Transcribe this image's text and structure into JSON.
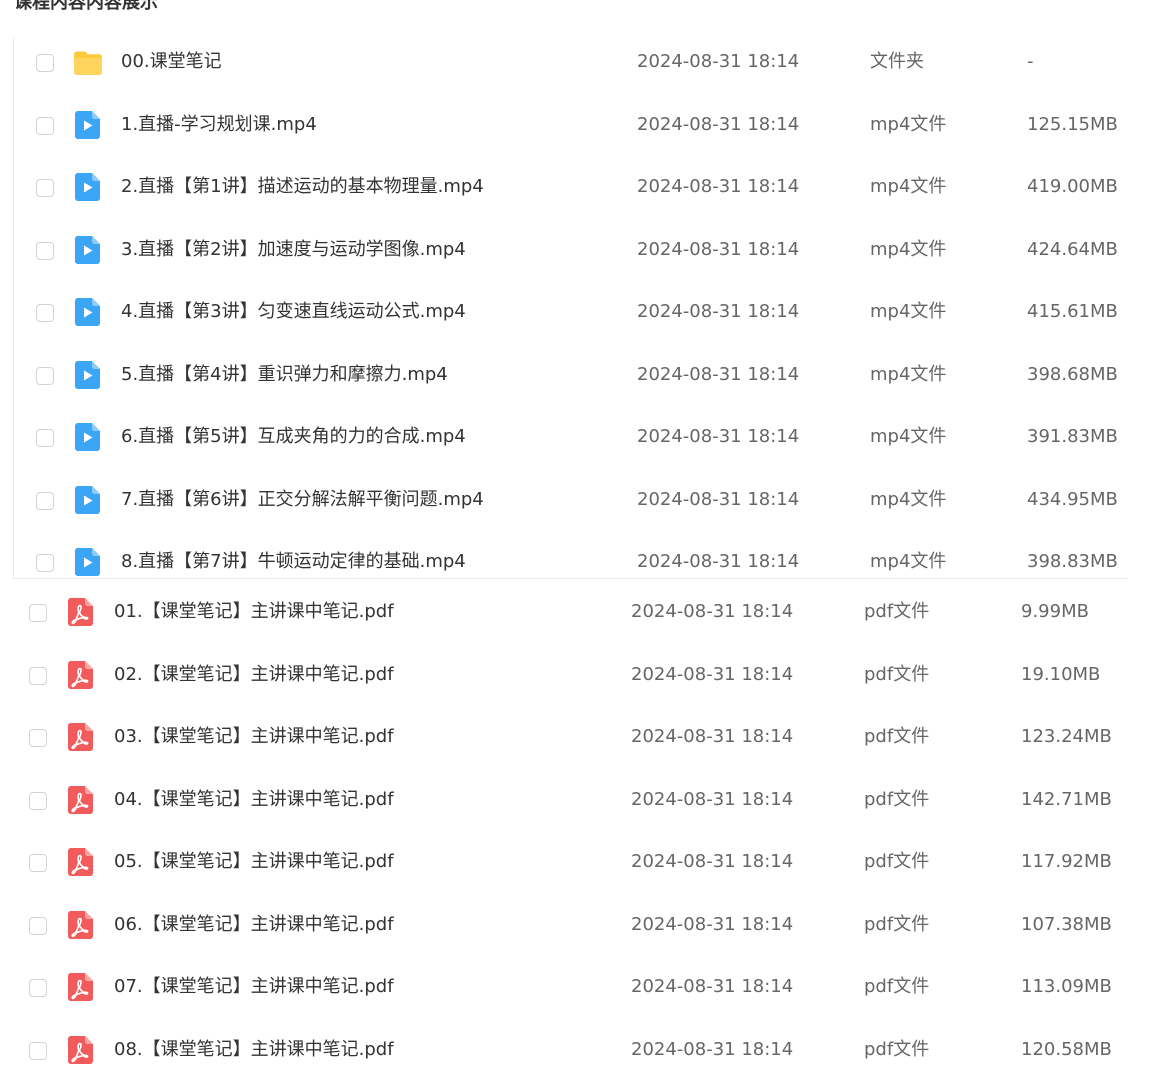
{
  "section_title": "课程内容内容展示",
  "colors": {
    "folder": "#FFC93C",
    "video": "#3BA6F5",
    "pdf": "#F25B5B",
    "checkbox_border": "#D3D3D3",
    "panel_border": "#E8E8E8"
  },
  "files": [
    {
      "name": "00.课堂笔记",
      "date": "2024-08-31 18:14",
      "type": "文件夹",
      "size": "-",
      "icon": "folder-icon"
    },
    {
      "name": "1.直播-学习规划课.mp4",
      "date": "2024-08-31 18:14",
      "type": "mp4文件",
      "size": "125.15MB",
      "icon": "video-file-icon"
    },
    {
      "name": "2.直播【第1讲】描述运动的基本物理量.mp4",
      "date": "2024-08-31 18:14",
      "type": "mp4文件",
      "size": "419.00MB",
      "icon": "video-file-icon"
    },
    {
      "name": "3.直播【第2讲】加速度与运动学图像.mp4",
      "date": "2024-08-31 18:14",
      "type": "mp4文件",
      "size": "424.64MB",
      "icon": "video-file-icon"
    },
    {
      "name": "4.直播【第3讲】匀变速直线运动公式.mp4",
      "date": "2024-08-31 18:14",
      "type": "mp4文件",
      "size": "415.61MB",
      "icon": "video-file-icon"
    },
    {
      "name": "5.直播【第4讲】重识弹力和摩擦力.mp4",
      "date": "2024-08-31 18:14",
      "type": "mp4文件",
      "size": "398.68MB",
      "icon": "video-file-icon"
    },
    {
      "name": "6.直播【第5讲】互成夹角的力的合成.mp4",
      "date": "2024-08-31 18:14",
      "type": "mp4文件",
      "size": "391.83MB",
      "icon": "video-file-icon"
    },
    {
      "name": "7.直播【第6讲】正交分解法解平衡问题.mp4",
      "date": "2024-08-31 18:14",
      "type": "mp4文件",
      "size": "434.95MB",
      "icon": "video-file-icon"
    },
    {
      "name": "8.直播【第7讲】牛顿运动定律的基础.mp4",
      "date": "2024-08-31 18:14",
      "type": "mp4文件",
      "size": "398.83MB",
      "icon": "video-file-icon"
    },
    {
      "name": "01.【课堂笔记】主讲课中笔记.pdf",
      "date": "2024-08-31 18:14",
      "type": "pdf文件",
      "size": "9.99MB",
      "icon": "pdf-file-icon"
    },
    {
      "name": "02.【课堂笔记】主讲课中笔记.pdf",
      "date": "2024-08-31 18:14",
      "type": "pdf文件",
      "size": "19.10MB",
      "icon": "pdf-file-icon"
    },
    {
      "name": "03.【课堂笔记】主讲课中笔记.pdf",
      "date": "2024-08-31 18:14",
      "type": "pdf文件",
      "size": "123.24MB",
      "icon": "pdf-file-icon"
    },
    {
      "name": "04.【课堂笔记】主讲课中笔记.pdf",
      "date": "2024-08-31 18:14",
      "type": "pdf文件",
      "size": "142.71MB",
      "icon": "pdf-file-icon"
    },
    {
      "name": "05.【课堂笔记】主讲课中笔记.pdf",
      "date": "2024-08-31 18:14",
      "type": "pdf文件",
      "size": "117.92MB",
      "icon": "pdf-file-icon"
    },
    {
      "name": "06.【课堂笔记】主讲课中笔记.pdf",
      "date": "2024-08-31 18:14",
      "type": "pdf文件",
      "size": "107.38MB",
      "icon": "pdf-file-icon"
    },
    {
      "name": "07.【课堂笔记】主讲课中笔记.pdf",
      "date": "2024-08-31 18:14",
      "type": "pdf文件",
      "size": "113.09MB",
      "icon": "pdf-file-icon"
    },
    {
      "name": "08.【课堂笔记】主讲课中笔记.pdf",
      "date": "2024-08-31 18:14",
      "type": "pdf文件",
      "size": "120.58MB",
      "icon": "pdf-file-icon"
    }
  ]
}
